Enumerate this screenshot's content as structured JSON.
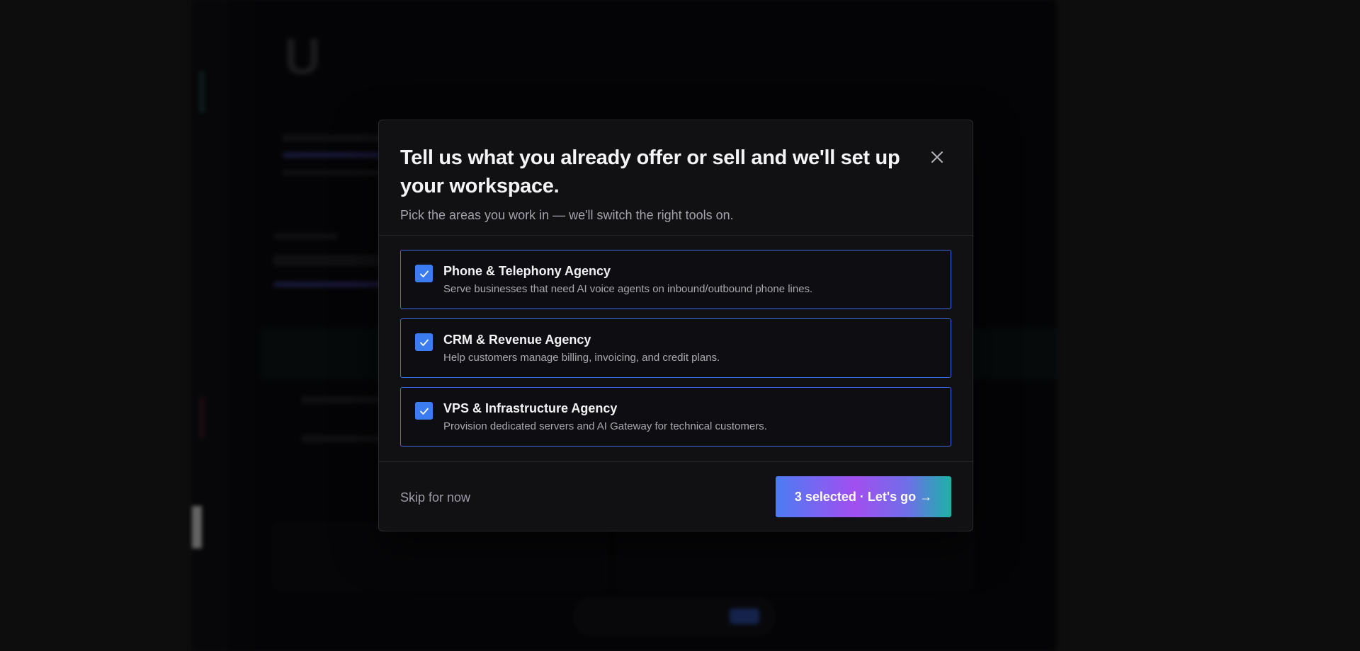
{
  "modal": {
    "title": "Tell us what you already offer or sell and we'll set up your workspace.",
    "subtitle": "Pick the areas you work in — we'll switch the right tools on.",
    "close_icon": "close-icon",
    "options": [
      {
        "title": "Phone & Telephony Agency",
        "description": "Serve businesses that need AI voice agents on inbound/outbound phone lines.",
        "checked": true
      },
      {
        "title": "CRM & Revenue Agency",
        "description": "Help customers manage billing, invoicing, and credit plans.",
        "checked": true
      },
      {
        "title": "VPS & Infrastructure Agency",
        "description": "Provision dedicated servers and AI Gateway for technical customers.",
        "checked": true
      }
    ],
    "footer": {
      "skip_label": "Skip for now",
      "go_label": "3 selected · Let's go →"
    }
  },
  "colors": {
    "accent": "#3b7cf0",
    "border_selected": "#3b6be6",
    "modal_bg": "#111114",
    "gradient_start": "#4c7cf3",
    "gradient_mid": "#a24ff0",
    "gradient_end": "#1bb3a6"
  }
}
